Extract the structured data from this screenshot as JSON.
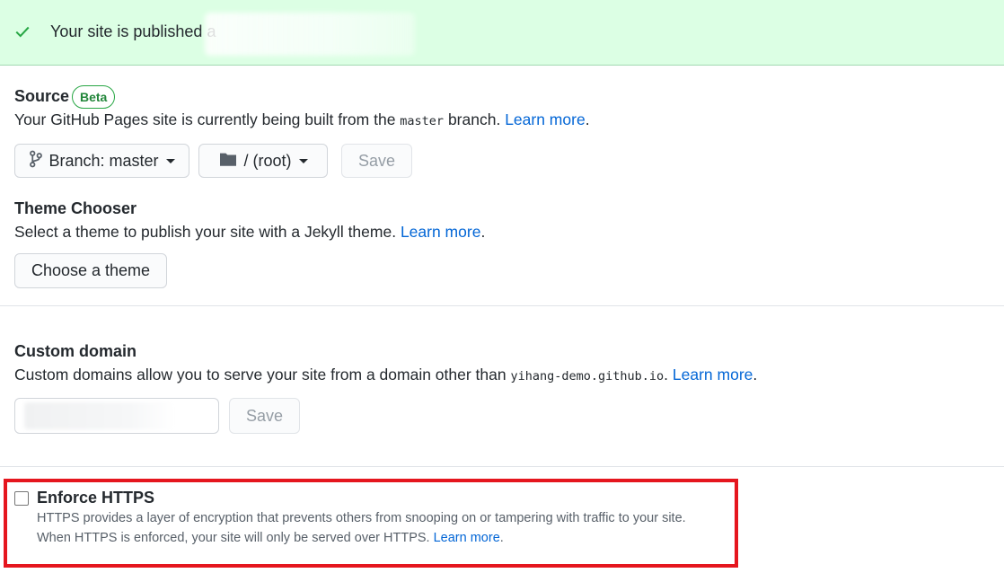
{
  "banner": {
    "message": "Your site is published a",
    "icon": "check-icon",
    "color": "#dcffe4"
  },
  "source": {
    "title": "Source",
    "badge": "Beta",
    "desc_prefix": "Your GitHub Pages site is currently being built from the ",
    "branch_code": "master",
    "desc_suffix": " branch. ",
    "learn_more": "Learn more",
    "period": ".",
    "branch_button": "Branch: master",
    "folder_button": "/ (root)",
    "save_button": "Save"
  },
  "theme": {
    "title": "Theme Chooser",
    "desc": "Select a theme to publish your site with a Jekyll theme. ",
    "learn_more": "Learn more",
    "period": ".",
    "button": "Choose a theme"
  },
  "custom_domain": {
    "title": "Custom domain",
    "desc_prefix": "Custom domains allow you to serve your site from a domain other than ",
    "domain_code": "yihang-demo.github.io",
    "desc_suffix": ". ",
    "learn_more": "Learn more",
    "period": ".",
    "input_value": "",
    "save_button": "Save"
  },
  "https": {
    "title": "Enforce HTTPS",
    "checked": false,
    "line1": "HTTPS provides a layer of encryption that prevents others from snooping on or tampering with traffic to your site.",
    "line2": "When HTTPS is enforced, your site will only be served over HTTPS. ",
    "learn_more": "Learn more",
    "period": "."
  },
  "colors": {
    "link": "#0366d6",
    "highlight_border": "#e5161e",
    "success": "#28a745"
  }
}
